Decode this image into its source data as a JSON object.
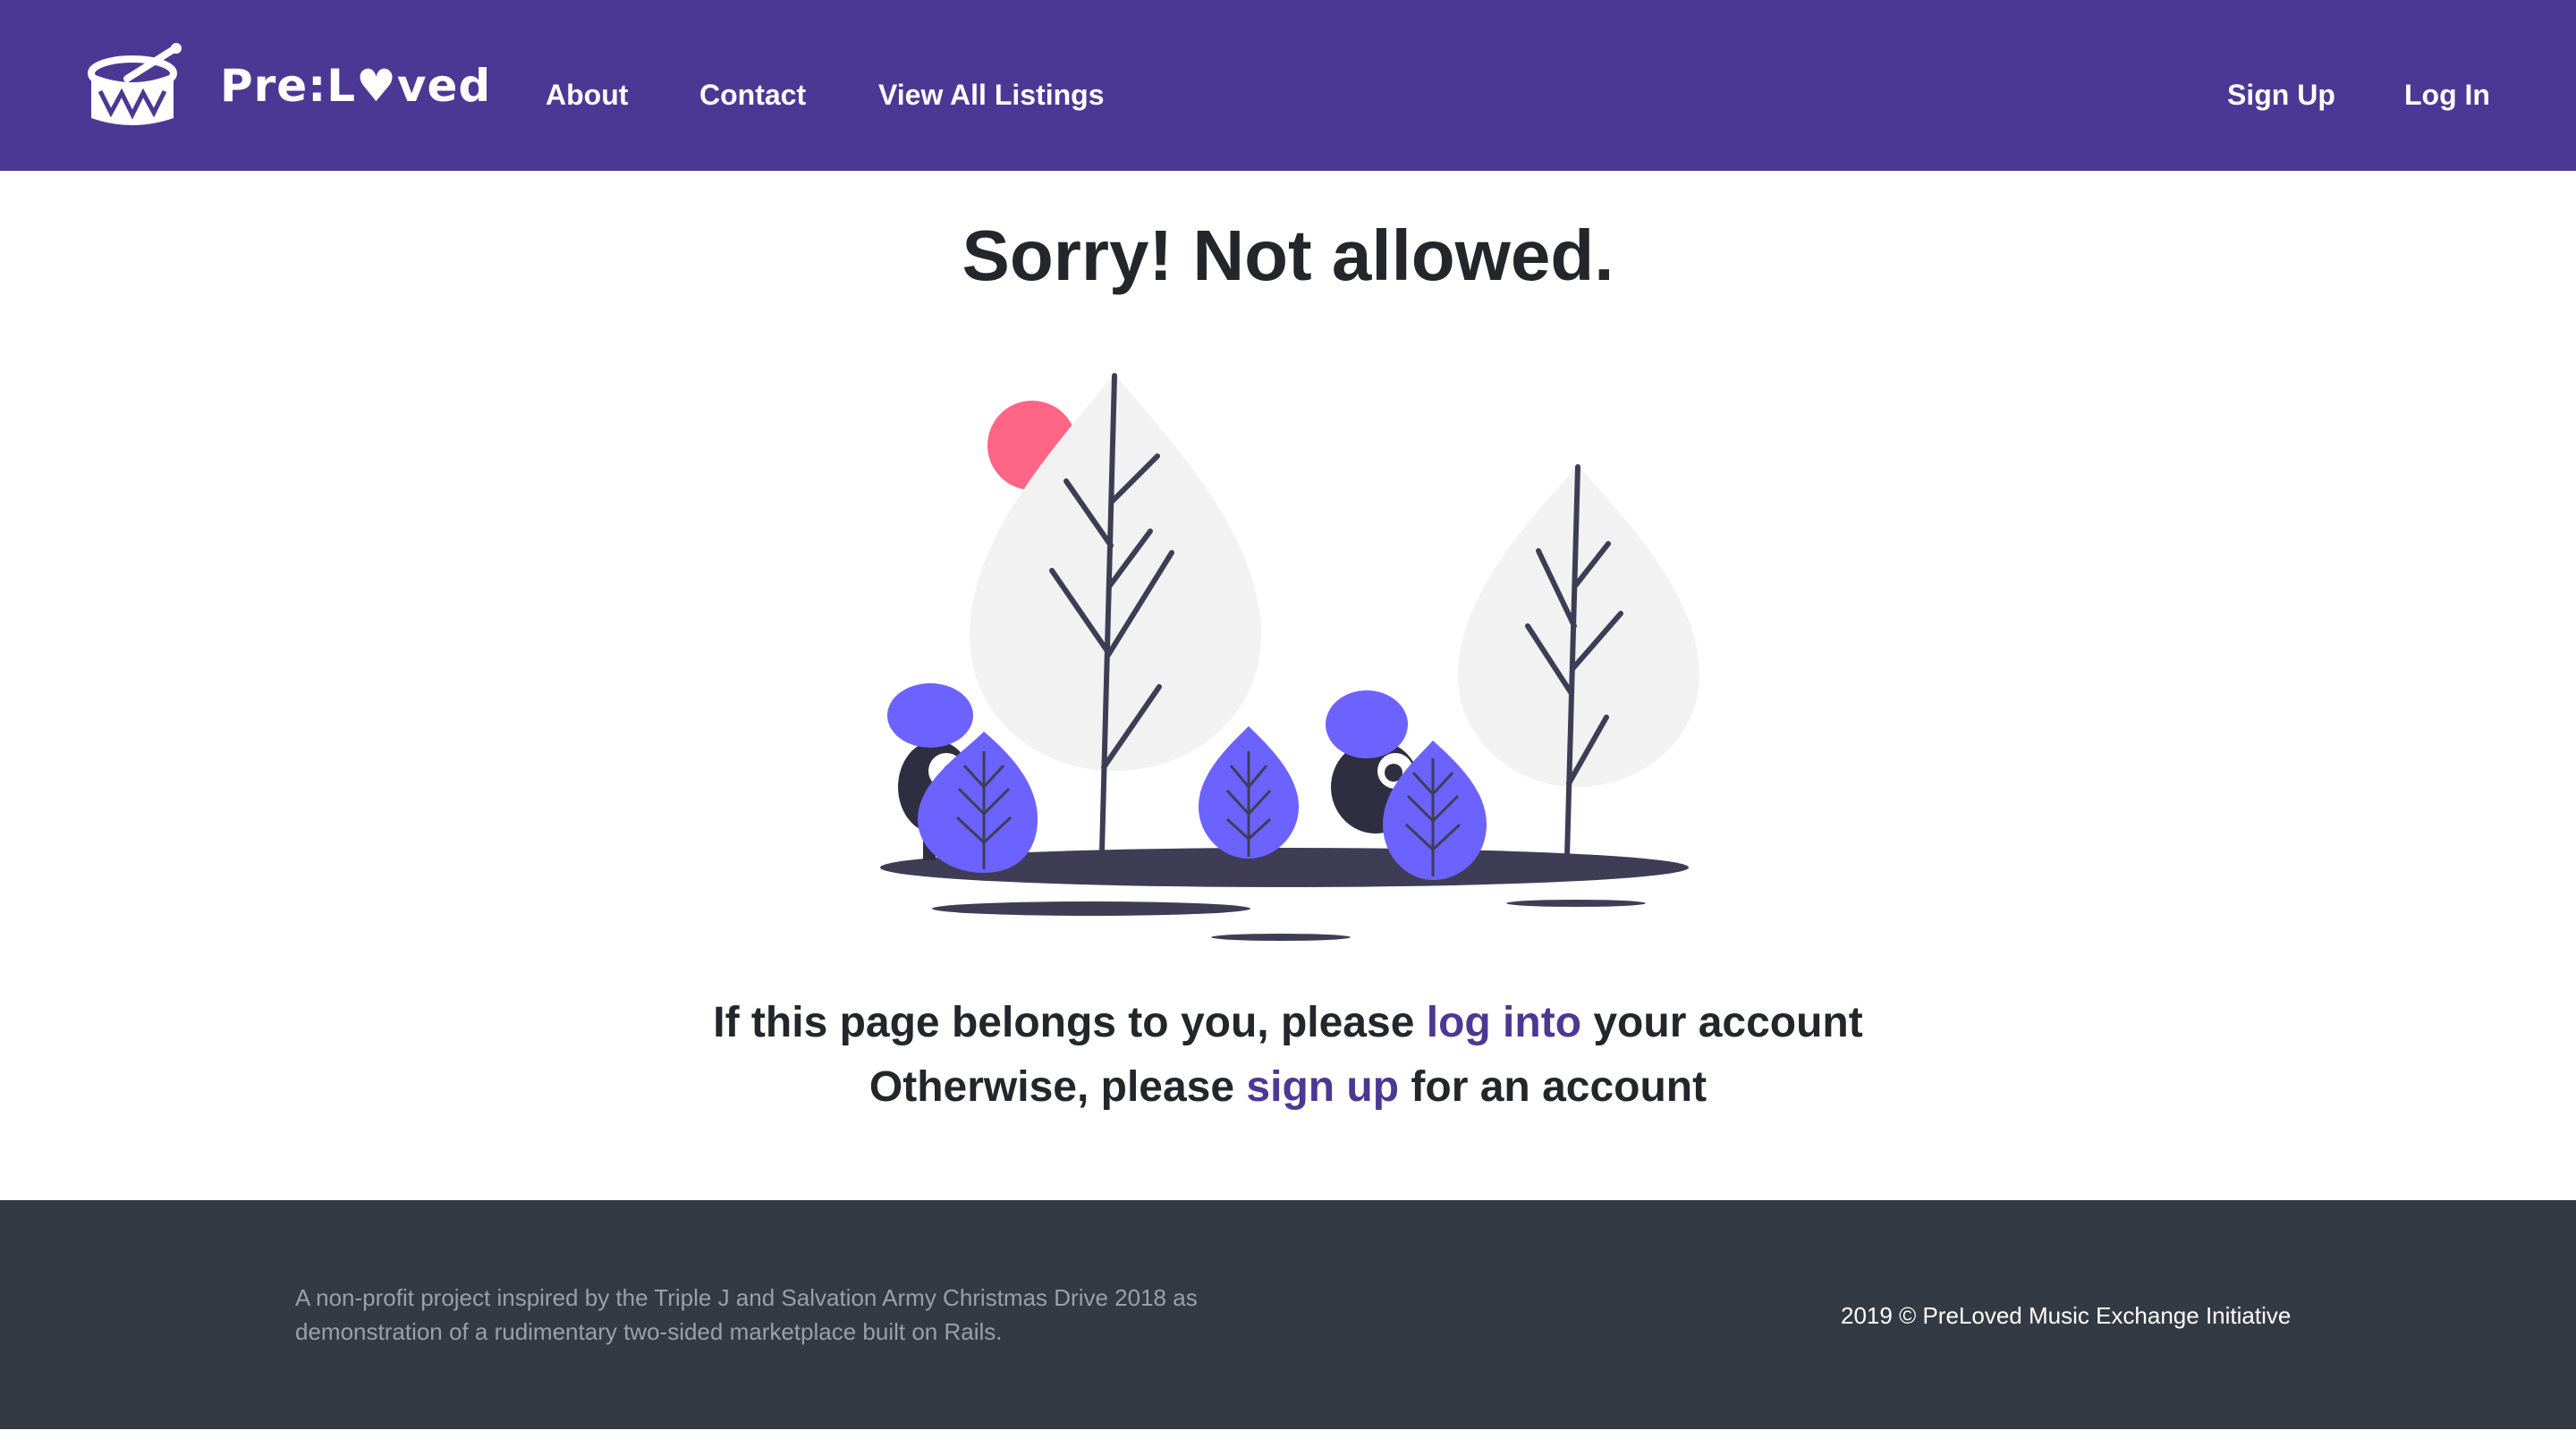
{
  "colors": {
    "brand": "#4b3894",
    "footer_bg": "#343a43",
    "link": "#4b3894",
    "accent_person": "#6c63ff",
    "sun": "#ff6584",
    "tree": "#f2f2f2",
    "dark": "#3f3d56"
  },
  "header": {
    "logo_icon": "drum-icon",
    "brand": "Pre:L♥ved",
    "nav": {
      "about": "About",
      "contact": "Contact",
      "listings": "View All Listings",
      "signup": "Sign Up",
      "login": "Log In"
    }
  },
  "main": {
    "title": "Sorry! Not allowed.",
    "illustration": "trees-and-people-illustration",
    "line1": {
      "before": "If this page belongs to you, please ",
      "link": "log into",
      "after": " your account"
    },
    "line2": {
      "before": "Otherwise, please ",
      "link": "sign up",
      "after": " for an account"
    }
  },
  "footer": {
    "note": "A non-profit project inspired by the Triple J and Salvation Army Christmas Drive 2018 as demonstration of a rudimentary two-sided marketplace built on Rails.",
    "copyright": "2019 © PreLoved Music Exchange Initiative"
  }
}
